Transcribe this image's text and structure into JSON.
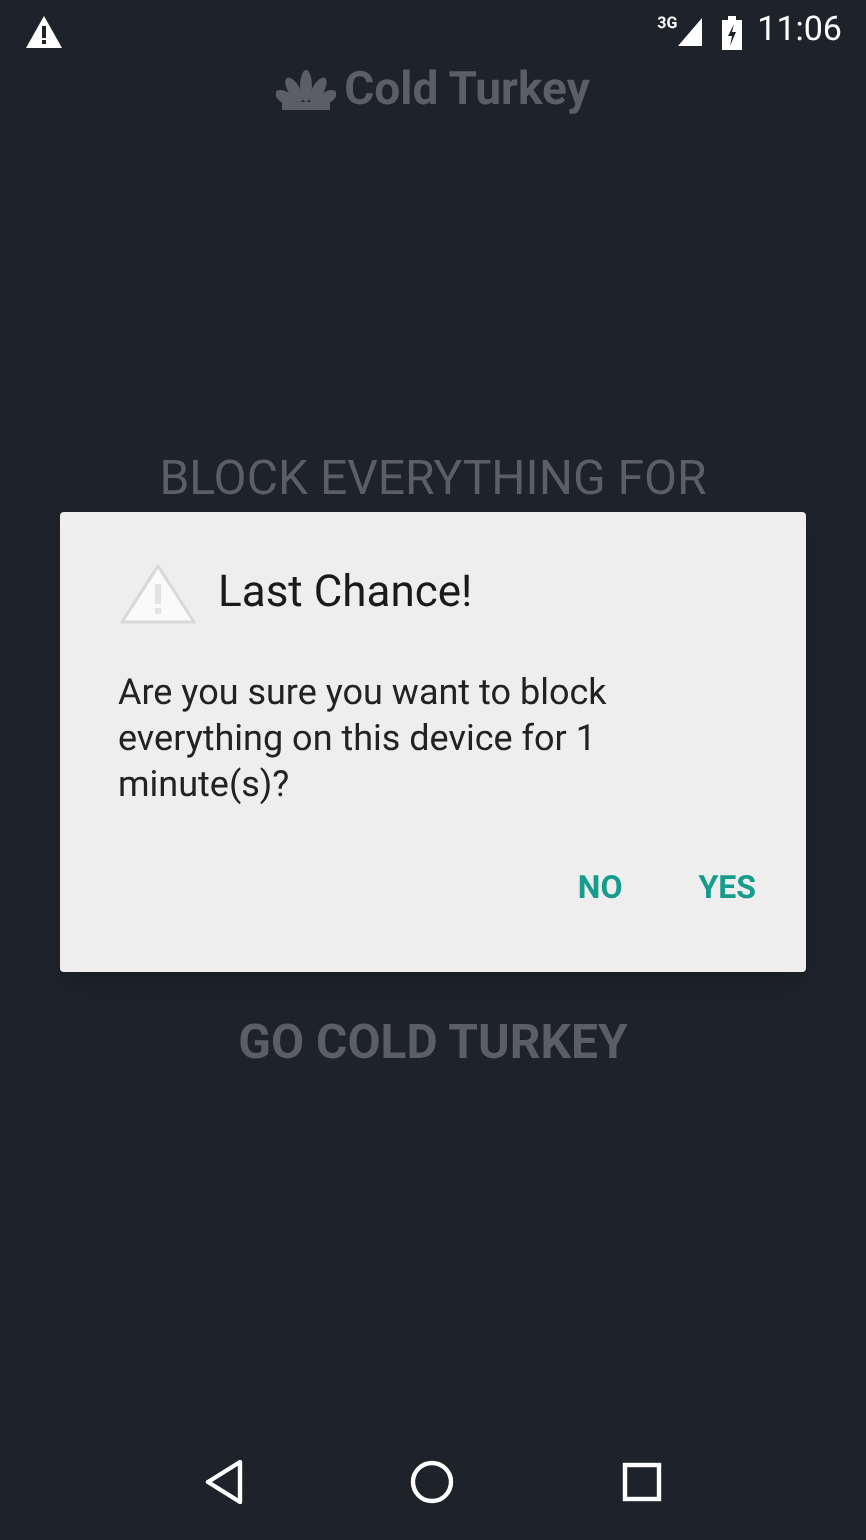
{
  "status_bar": {
    "network": "3G",
    "time": "11:06"
  },
  "app_title": "Cold Turkey",
  "heading": "BLOCK EVERYTHING FOR",
  "action": "GO COLD TURKEY",
  "dialog": {
    "title": "Last Chance!",
    "message": "Are you sure you want to block everything on this device for 1 minute(s)?",
    "buttons": [
      "NO",
      "YES"
    ]
  }
}
